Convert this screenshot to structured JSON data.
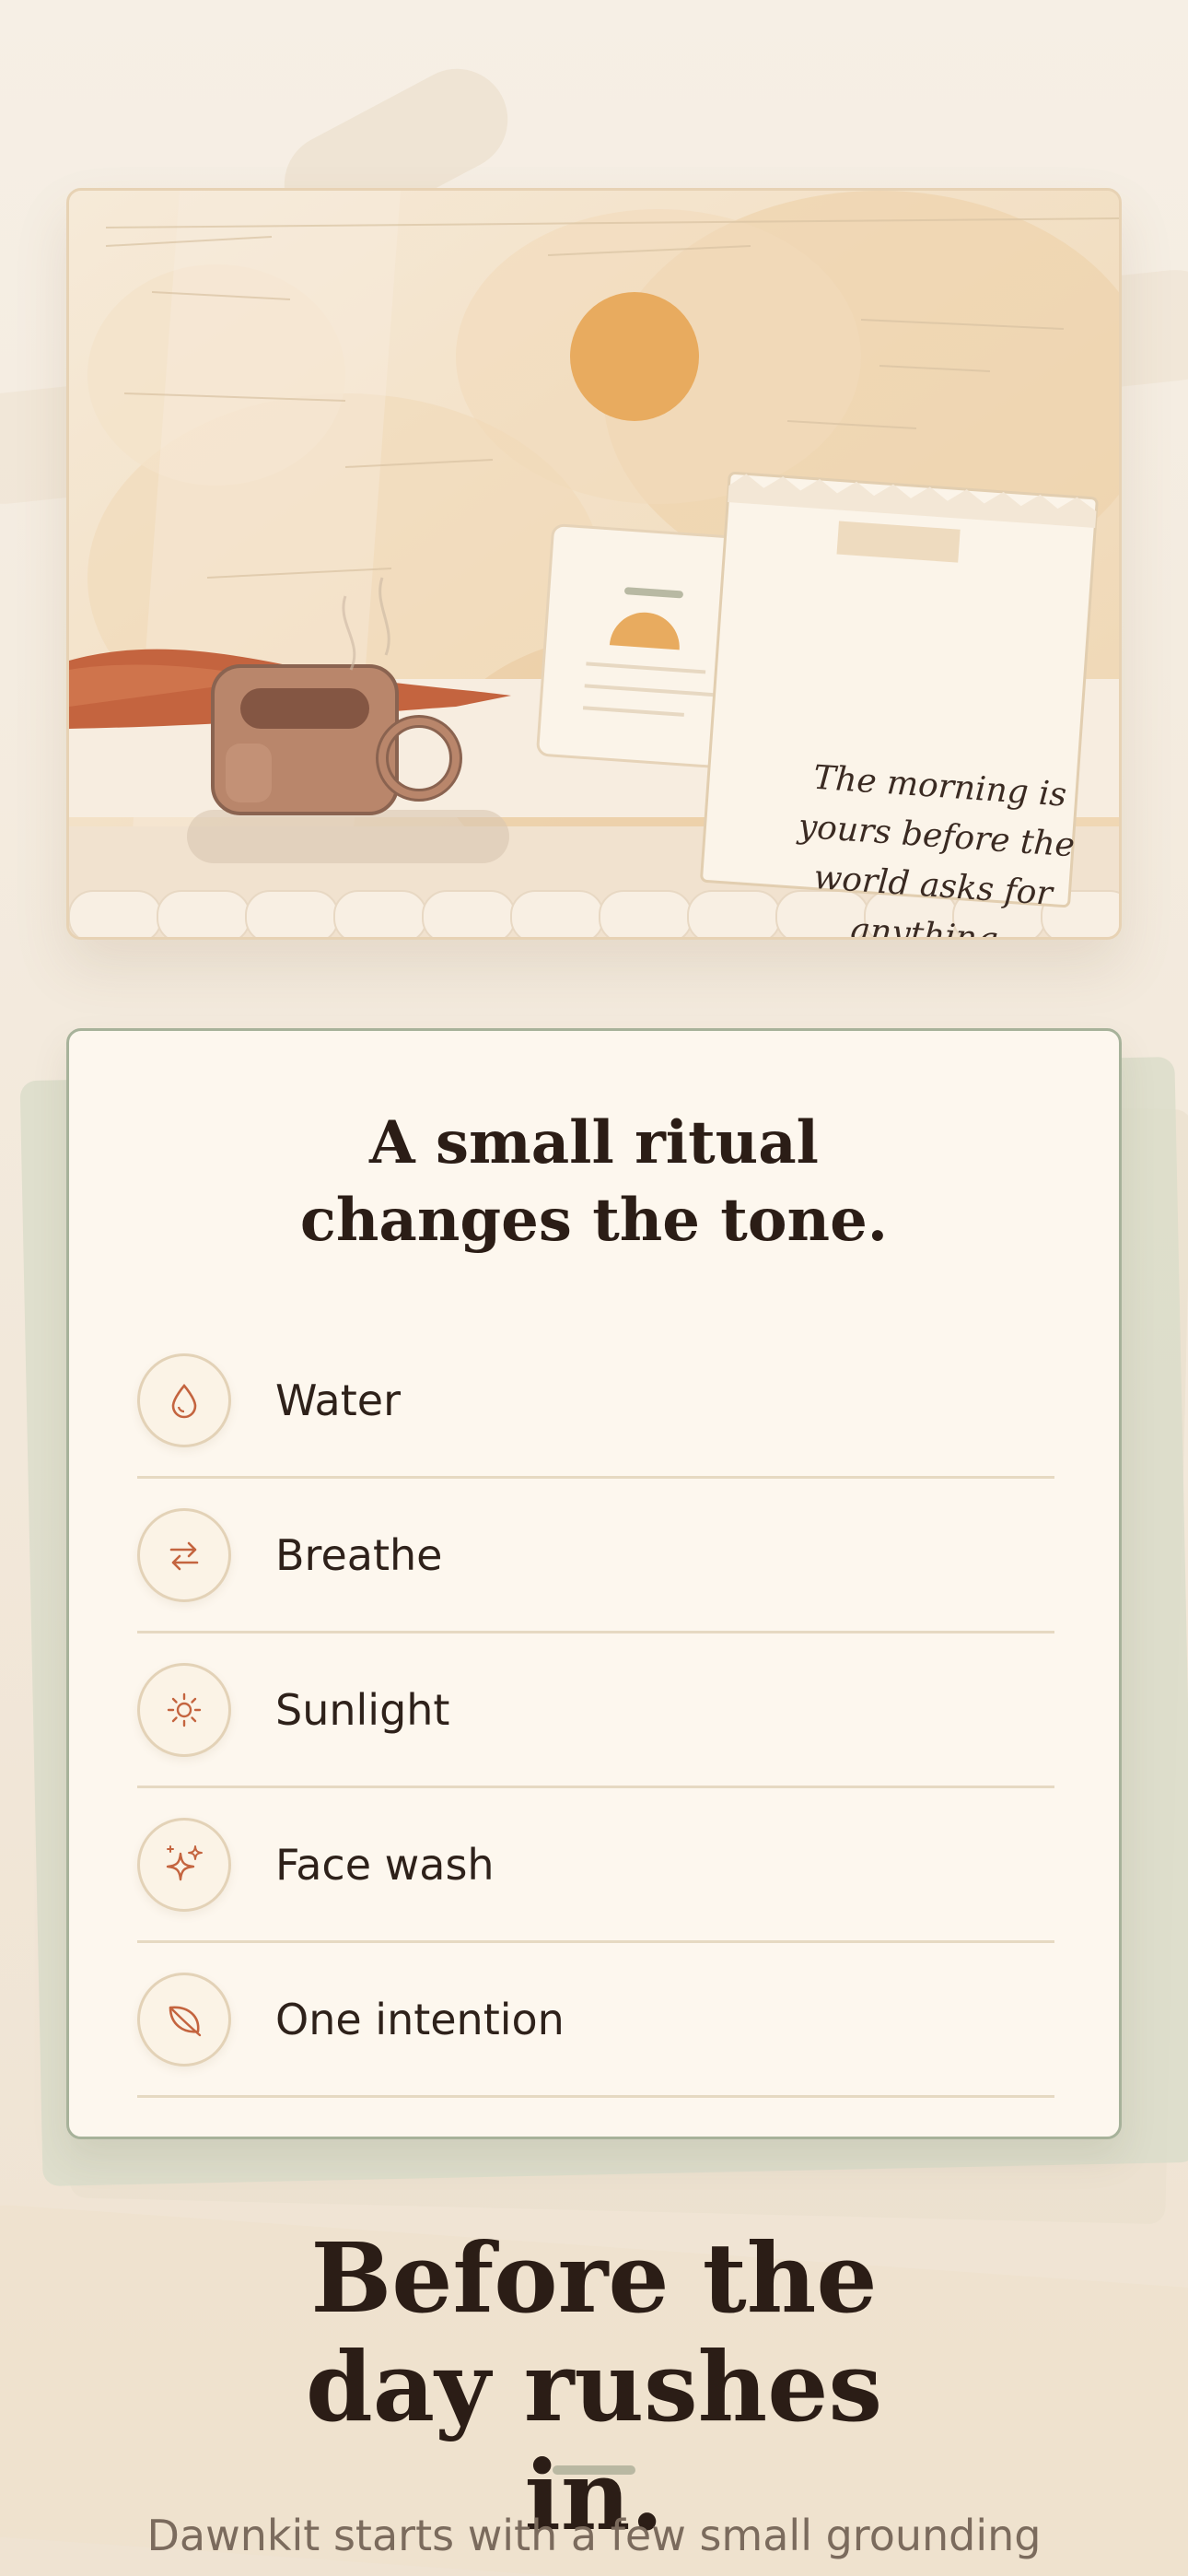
{
  "hero": {
    "note_quote": "The morning is yours before the world asks for anything."
  },
  "ritual": {
    "title": "A small ritual changes the tone.",
    "items": [
      {
        "label": "Water",
        "icon": "water-drop-icon"
      },
      {
        "label": "Breathe",
        "icon": "arrows-exchange-icon"
      },
      {
        "label": "Sunlight",
        "icon": "sun-icon"
      },
      {
        "label": "Face wash",
        "icon": "sparkles-icon"
      },
      {
        "label": "One intention",
        "icon": "leaf-icon"
      }
    ]
  },
  "intro": {
    "headline": "Before the day rushes in.",
    "subline": "Dawnkit starts with a few small grounding"
  },
  "colors": {
    "accent": "#c4643f",
    "sun": "#e8ab5f",
    "card_border": "#a7b29a",
    "background": "#f5ede1"
  }
}
